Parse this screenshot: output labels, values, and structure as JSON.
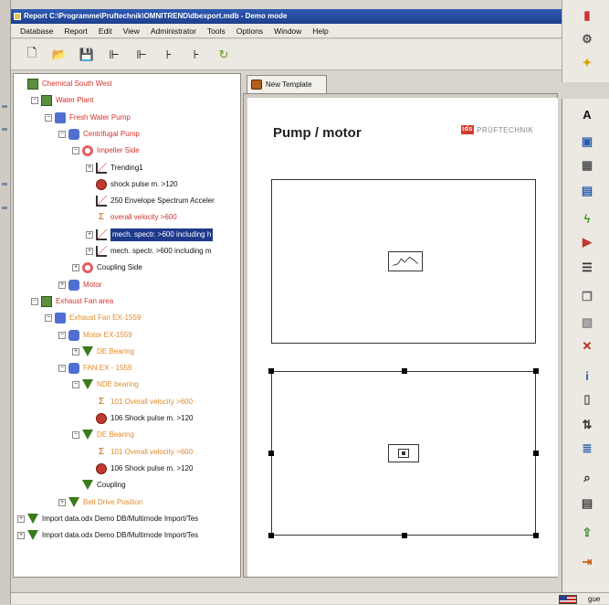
{
  "window": {
    "title": "Report C:\\Programme\\Pruftechnik\\OMNITREND\\dbexport.mdb - Demo mode"
  },
  "menu": [
    "Database",
    "Report",
    "Edit",
    "View",
    "Administrator",
    "Tools",
    "Options",
    "Window",
    "Help"
  ],
  "toolbar_icons": [
    "new-document-icon",
    "open-folder-icon",
    "save-disk-icon",
    "tree-branch-icon",
    "tree-branch-alt-icon",
    "tree-node-icon",
    "tree-node-alt-icon",
    "refresh-arrow-icon"
  ],
  "tree": [
    {
      "label": "Chemical South West",
      "color": "red",
      "icon": "plant",
      "depth": 0,
      "toggle": ""
    },
    {
      "label": "Water Plant",
      "color": "red",
      "icon": "plant",
      "depth": 1,
      "toggle": "-"
    },
    {
      "label": "Fresh Water Pump",
      "color": "red",
      "icon": "pump",
      "depth": 2,
      "toggle": "-"
    },
    {
      "label": "Centrifugal Pump",
      "color": "red",
      "icon": "motor",
      "depth": 3,
      "toggle": "-"
    },
    {
      "label": "Impeller Side",
      "color": "red",
      "icon": "coupling",
      "depth": 4,
      "toggle": "-"
    },
    {
      "label": "Trending1",
      "color": "",
      "icon": "chart",
      "depth": 5,
      "toggle": "+"
    },
    {
      "label": "shock pulse m. >120",
      "color": "",
      "icon": "shock",
      "depth": 5,
      "toggle": ""
    },
    {
      "label": "250 Envelope Spectrum Acceler",
      "color": "",
      "icon": "chart",
      "depth": 5,
      "toggle": ""
    },
    {
      "label": "overall velocity >600",
      "color": "red",
      "icon": "sigma",
      "depth": 5,
      "toggle": ""
    },
    {
      "label": "mech. spectr. >600 including h",
      "color": "sel",
      "icon": "chart",
      "depth": 5,
      "toggle": "+"
    },
    {
      "label": "mech. spectr. >600 including m",
      "color": "",
      "icon": "chart",
      "depth": 5,
      "toggle": "+"
    },
    {
      "label": "Coupling Side",
      "color": "",
      "icon": "coupling",
      "depth": 4,
      "toggle": "+"
    },
    {
      "label": "Motor",
      "color": "red",
      "icon": "motor",
      "depth": 3,
      "toggle": "+"
    },
    {
      "label": "Exhaust Fan area",
      "color": "red",
      "icon": "plant",
      "depth": 1,
      "toggle": "-"
    },
    {
      "label": "Exhaust Fan EX-1559",
      "color": "orange",
      "icon": "pump",
      "depth": 2,
      "toggle": "-"
    },
    {
      "label": "Motor EX-1559",
      "color": "orange",
      "icon": "motor",
      "depth": 3,
      "toggle": "-"
    },
    {
      "label": "DE Bearing",
      "color": "orange",
      "icon": "bearing",
      "depth": 4,
      "toggle": "+"
    },
    {
      "label": "FAN EX - 1559",
      "color": "orange",
      "icon": "motor",
      "depth": 3,
      "toggle": "-"
    },
    {
      "label": "NDE bearing",
      "color": "orange",
      "icon": "bearing",
      "depth": 4,
      "toggle": "-"
    },
    {
      "label": "101 Overall velocity >600",
      "color": "orange",
      "icon": "sigma",
      "depth": 5,
      "toggle": ""
    },
    {
      "label": "106 Shock pulse m. >120",
      "color": "",
      "icon": "shock",
      "depth": 5,
      "toggle": ""
    },
    {
      "label": "DE Bearing",
      "color": "orange",
      "icon": "bearing",
      "depth": 4,
      "toggle": "-"
    },
    {
      "label": "101 Overall velocity >600",
      "color": "orange",
      "icon": "sigma",
      "depth": 5,
      "toggle": ""
    },
    {
      "label": "106 Shock pulse m. >120",
      "color": "",
      "icon": "shock",
      "depth": 5,
      "toggle": ""
    },
    {
      "label": "Coupling",
      "color": "",
      "icon": "bearing",
      "depth": 4,
      "toggle": ""
    },
    {
      "label": "Belt Drive Position",
      "color": "orange",
      "icon": "bearing",
      "depth": 3,
      "toggle": "+"
    },
    {
      "label": "Import data.odx Demo DB/Multimode Import/Tes",
      "color": "",
      "icon": "bearing",
      "depth": 0,
      "toggle": "+"
    },
    {
      "label": "Import data.odx Demo DB/Multimode Import/Tes",
      "color": "",
      "icon": "bearing",
      "depth": 0,
      "toggle": "+"
    }
  ],
  "tab": {
    "label": "New Template"
  },
  "template": {
    "title": "Pump / motor",
    "brand_mark": "ids",
    "brand_name": "PRÜFTECHNIK"
  },
  "right_toolbar_icons": [
    "text-a-icon",
    "image-icon",
    "chart-grid-icon",
    "table-grid-icon",
    "lightning-icon",
    "flag-arrow-icon",
    "list-icon",
    "copy-icon",
    "paste-icon",
    "delete-x-icon",
    "info-icon",
    "document-icon",
    "align-icon",
    "settings-list-icon",
    "zoom-icon",
    "preview-icon",
    "export-icon",
    "exit-icon"
  ],
  "status": {
    "user": "gue"
  }
}
